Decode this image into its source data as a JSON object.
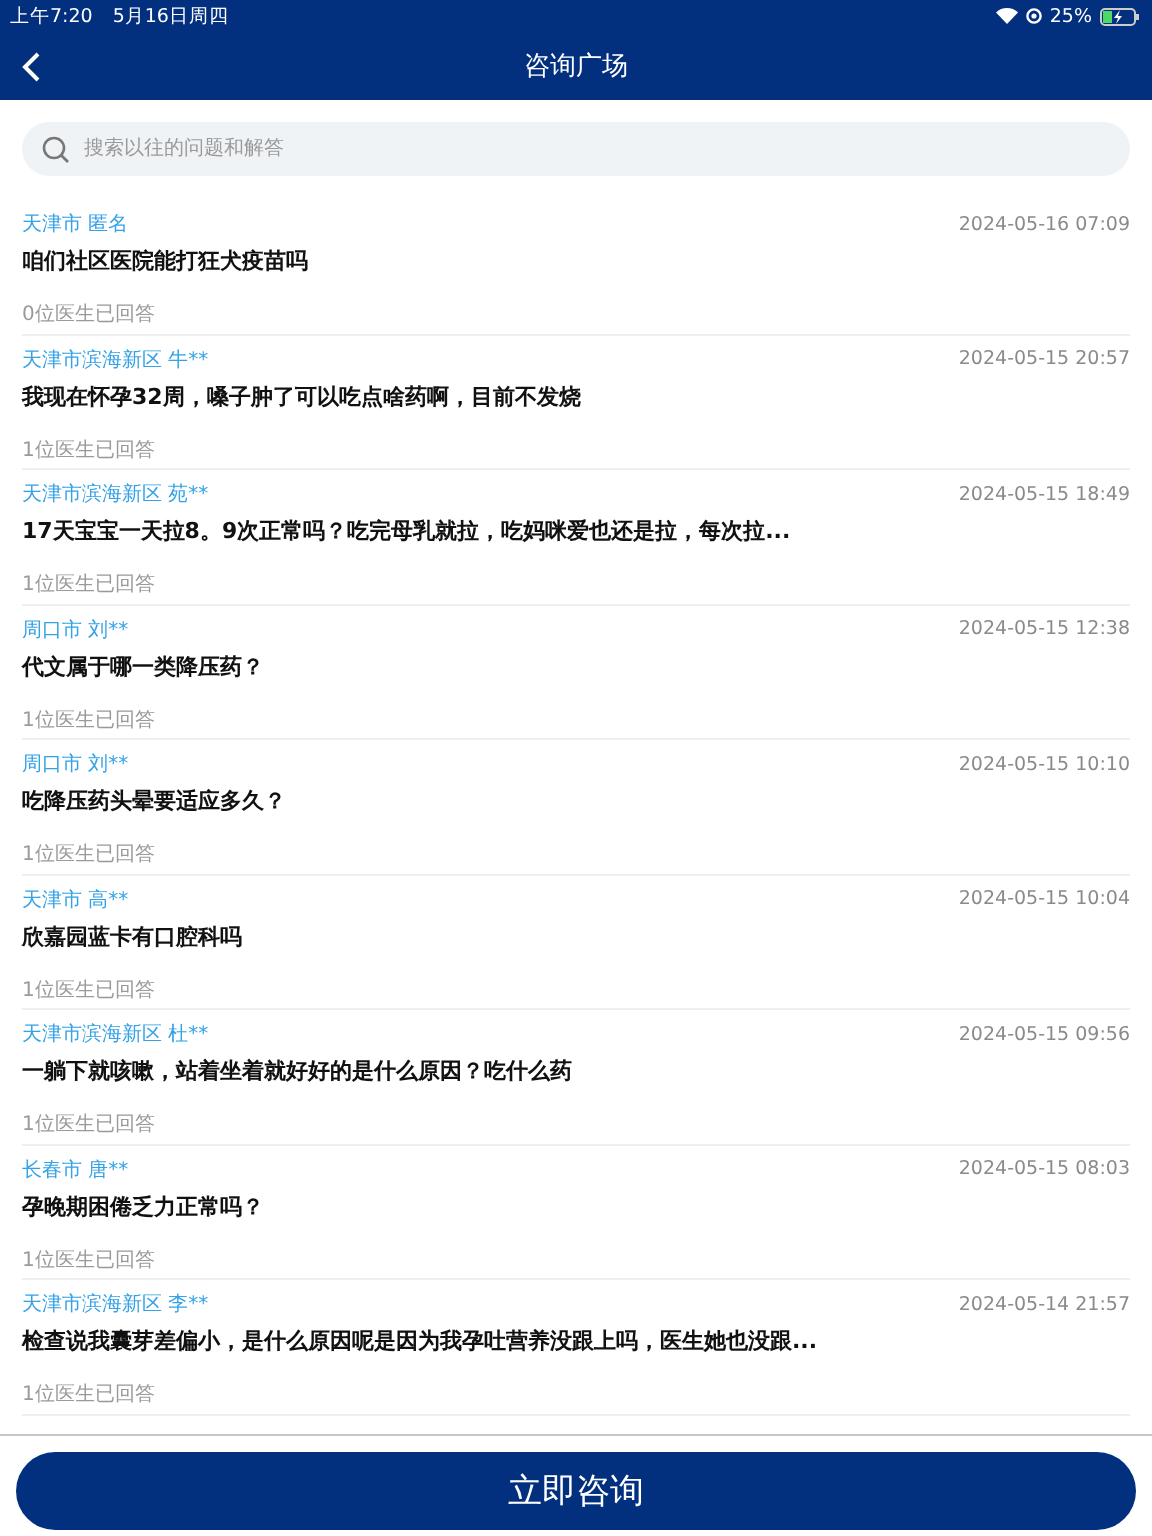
{
  "status_bar": {
    "time": "上午7:20",
    "date": "5月16日周四",
    "battery": "25%"
  },
  "nav": {
    "title": "咨询广场"
  },
  "search": {
    "placeholder": "搜索以往的问题和解答"
  },
  "questions": [
    {
      "location": "天津市 匿名",
      "time": "2024-05-16 07:09",
      "question": "咱们社区医院能打狂犬疫苗吗",
      "answers": "0位医生已回答"
    },
    {
      "location": "天津市滨海新区 牛**",
      "time": "2024-05-15 20:57",
      "question": "我现在怀孕32周，嗓子肿了可以吃点啥药啊，目前不发烧",
      "answers": "1位医生已回答"
    },
    {
      "location": "天津市滨海新区 苑**",
      "time": "2024-05-15 18:49",
      "question": "17天宝宝一天拉8。9次正常吗？吃完母乳就拉，吃妈咪爱也还是拉，每次拉...",
      "answers": "1位医生已回答"
    },
    {
      "location": "周口市 刘**",
      "time": "2024-05-15 12:38",
      "question": "代文属于哪一类降压药？",
      "answers": "1位医生已回答"
    },
    {
      "location": "周口市 刘**",
      "time": "2024-05-15 10:10",
      "question": "吃降压药头晕要适应多久？",
      "answers": "1位医生已回答"
    },
    {
      "location": "天津市 高**",
      "time": "2024-05-15 10:04",
      "question": "欣嘉园蓝卡有口腔科吗",
      "answers": "1位医生已回答"
    },
    {
      "location": "天津市滨海新区 杜**",
      "time": "2024-05-15 09:56",
      "question": "一躺下就咳嗽，站着坐着就好好的是什么原因？吃什么药",
      "answers": "1位医生已回答"
    },
    {
      "location": "长春市 唐**",
      "time": "2024-05-15 08:03",
      "question": "孕晚期困倦乏力正常吗？",
      "answers": "1位医生已回答"
    },
    {
      "location": "天津市滨海新区 李**",
      "time": "2024-05-14 21:57",
      "question": "检查说我囊芽差偏小，是什么原因呢是因为我孕吐营养没跟上吗，医生她也没跟...",
      "answers": "1位医生已回答"
    }
  ],
  "action_button": "立即咨询"
}
